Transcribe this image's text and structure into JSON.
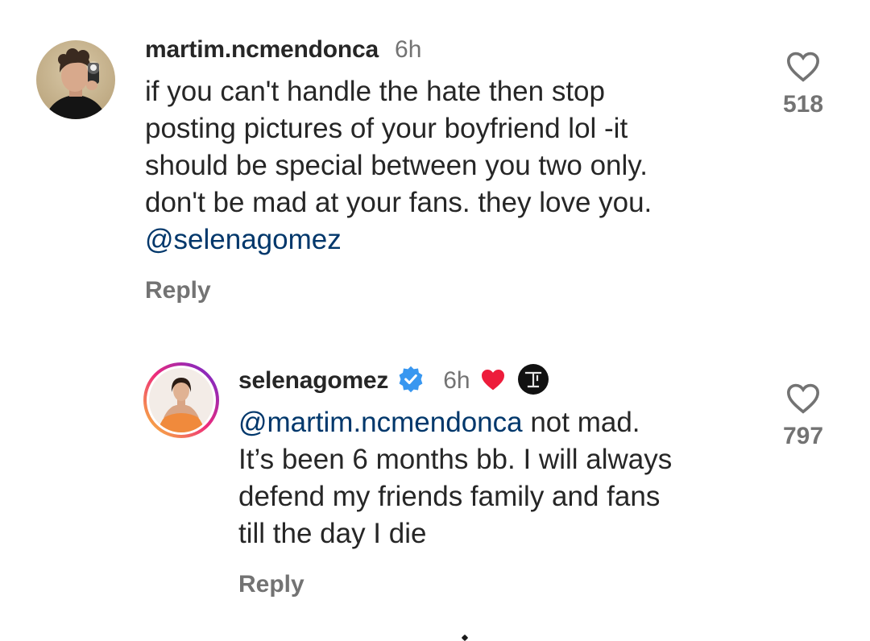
{
  "comments": [
    {
      "username": "martim.ncmendonca",
      "time": "6h",
      "text": "if you can't handle the hate then stop\nposting pictures of your boyfriend lol -it\nshould be special between you two only.\ndon't be mad at your fans. they love you.\n",
      "mention": "@selenagomez",
      "reply_label": "Reply",
      "like_count": "518"
    },
    {
      "username": "selenagomez",
      "time": "6h",
      "mention": "@martim.ncmendonca",
      "text": " not mad.\nIt’s been 6 months bb. I will always\ndefend my friends family and fans\ntill the day I die",
      "reply_label": "Reply",
      "like_count": "797",
      "icons": [
        "verified-badge-icon",
        "liked-by-author-heart-icon",
        "creator-logo-icon"
      ]
    }
  ],
  "colors": {
    "text": "#262626",
    "secondary": "#737373",
    "mention": "#00376b",
    "verified": "#3897f0",
    "heart": "#ed1c3b"
  }
}
